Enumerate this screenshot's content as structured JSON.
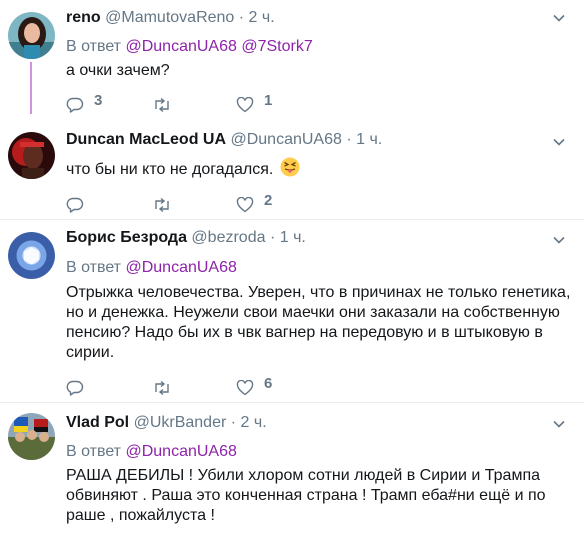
{
  "tweets": [
    {
      "name": "reno",
      "handle": "@MamutovaReno",
      "dot": "·",
      "time": "2 ч.",
      "reply_prefix": "В ответ",
      "reply_mentions": "@DuncanUA68 @7Stork7",
      "text": "а очки зачем?",
      "reply_count": "3",
      "retweet_count": "",
      "like_count": "1",
      "avatar": "woman-portrait"
    },
    {
      "name": "Duncan MacLeod UA",
      "handle": "@DuncanUA68",
      "dot": "·",
      "time": "1 ч.",
      "text": "что бы ни кто не догадался.",
      "emoji": "squinting-tongue-emoji",
      "reply_count": "",
      "retweet_count": "",
      "like_count": "2",
      "avatar": "man-red-portrait"
    },
    {
      "name": "Борис Безрода",
      "handle": "@bezroda",
      "dot": "·",
      "time": "1 ч.",
      "reply_prefix": "В ответ",
      "reply_mentions": "@DuncanUA68",
      "text": "Отрыжка человечества. Уверен, что в причинах не только генетика, но и денежка.  Неужели свои маечки они заказали на собственную пенсию? Надо бы их в чвк вагнер на передовую и в штыковую в сирии.",
      "reply_count": "",
      "retweet_count": "",
      "like_count": "6",
      "avatar": "glowing-cube"
    },
    {
      "name": "Vlad Pol",
      "handle": "@UkrBander",
      "dot": "·",
      "time": "2 ч.",
      "reply_prefix": "В ответ",
      "reply_mentions": "@DuncanUA68",
      "text": "РАША ДЕБИЛЫ !  Убили хлором сотни людей в Сирии и Трампа обвиняют . Раша это конченная страна ! Трамп еба#ни ещё и по раше , пожайлуста !",
      "avatar": "soldiers-with-flags"
    }
  ],
  "colors": {
    "mention": "#8e24aa",
    "secondary": "#657786",
    "thread_line": "#ce93d8",
    "separator": "#e6ecf0"
  },
  "icons": [
    "reply-icon",
    "retweet-icon",
    "like-icon",
    "caret-down-icon"
  ]
}
